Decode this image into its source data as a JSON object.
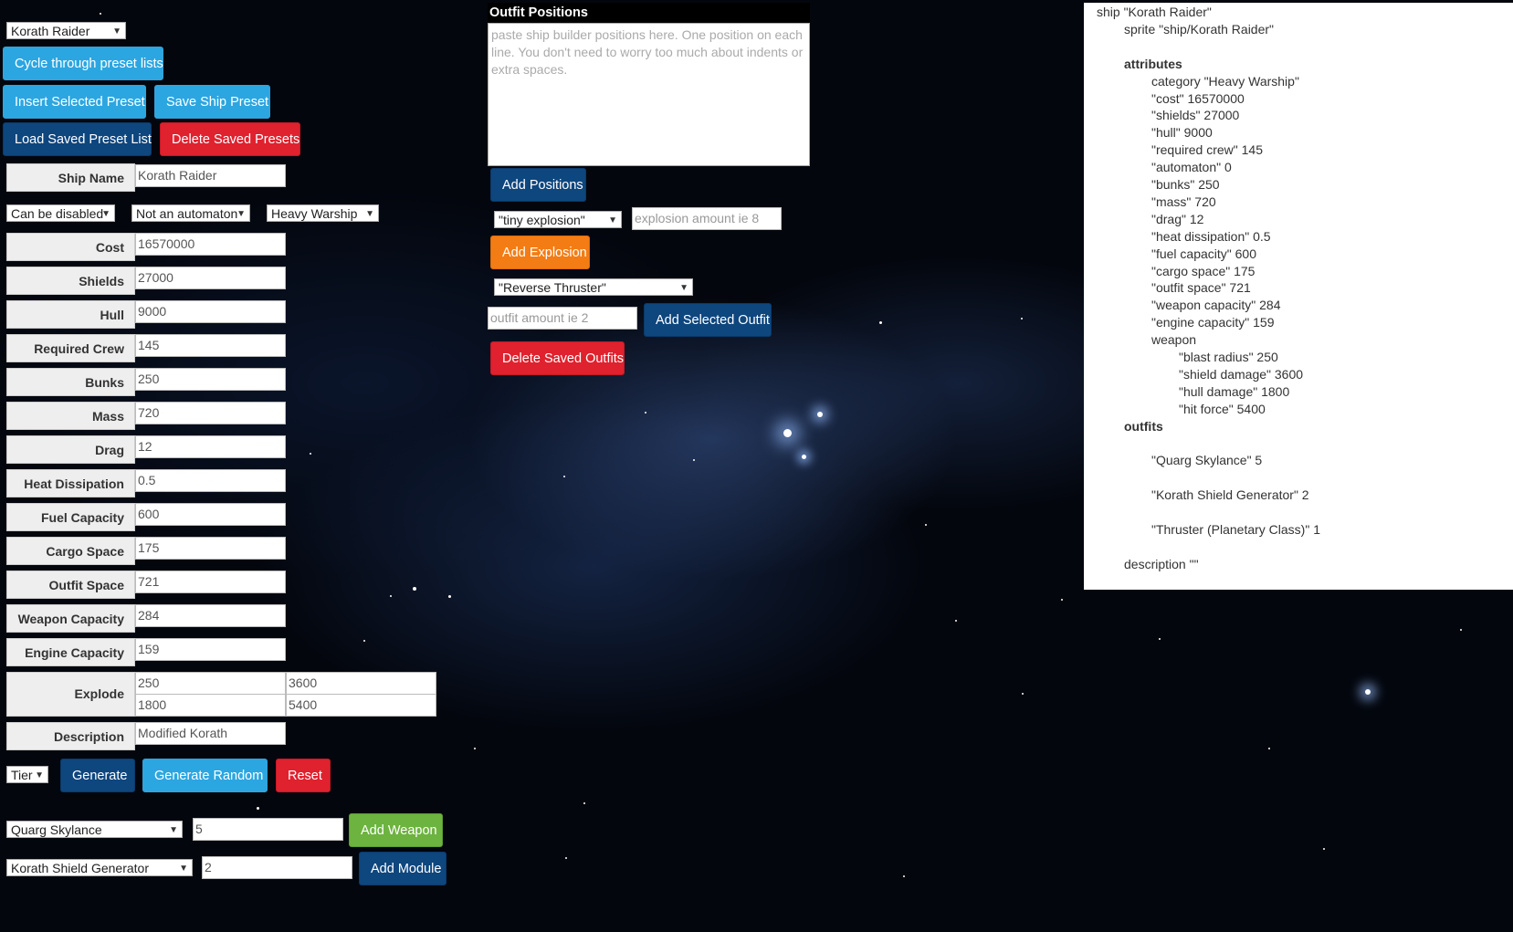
{
  "preset": {
    "selected": "Korath Raider",
    "cycle_label": "Cycle through preset lists",
    "insert_label": "Insert Selected Preset",
    "save_label": "Save Ship Preset",
    "load_label": "Load Saved Preset List",
    "delete_label": "Delete Saved Presets"
  },
  "ship_name": {
    "label": "Ship Name",
    "value": "Korath Raider"
  },
  "selects": {
    "disable": "Can be disabled",
    "automaton": "Not an automaton",
    "category": "Heavy Warship"
  },
  "fields": [
    {
      "label": "Cost",
      "value": "16570000"
    },
    {
      "label": "Shields",
      "value": "27000"
    },
    {
      "label": "Hull",
      "value": "9000"
    },
    {
      "label": "Required Crew",
      "value": "145"
    },
    {
      "label": "Bunks",
      "value": "250"
    },
    {
      "label": "Mass",
      "value": "720"
    },
    {
      "label": "Drag",
      "value": "12"
    },
    {
      "label": "Heat Dissipation",
      "value": "0.5"
    },
    {
      "label": "Fuel Capacity",
      "value": "600"
    },
    {
      "label": "Cargo Space",
      "value": "175"
    },
    {
      "label": "Outfit Space",
      "value": "721"
    },
    {
      "label": "Weapon Capacity",
      "value": "284"
    },
    {
      "label": "Engine Capacity",
      "value": "159"
    }
  ],
  "explode": {
    "label": "Explode",
    "blast_radius": "250",
    "shield_damage": "3600",
    "hull_damage": "1800",
    "hit_force": "5400"
  },
  "description": {
    "label": "Description",
    "value": "Modified Korath"
  },
  "generate": {
    "tier": "Tier",
    "generate_label": "Generate",
    "random_label": "Generate Random",
    "reset_label": "Reset"
  },
  "weapon": {
    "selected": "Quarg Skylance",
    "amount": "5",
    "add_label": "Add Weapon"
  },
  "module": {
    "selected": "Korath Shield Generator",
    "amount": "2",
    "add_label": "Add Module"
  },
  "outfit_positions": {
    "title": "Outfit Positions",
    "placeholder": "paste ship builder positions here. One position on each line. You don't need to worry too much about indents or extra spaces.",
    "add_positions_label": "Add Positions",
    "explosion_selected": "\"tiny explosion\"",
    "explosion_placeholder": "explosion amount ie 8",
    "add_explosion_label": "Add Explosion",
    "outfit_selected": "\"Reverse Thruster\"",
    "outfit_placeholder": "outfit amount ie 2",
    "add_outfit_label": "Add Selected Outfit",
    "delete_outfits_label": "Delete Saved Outfits"
  },
  "output": {
    "lines": [
      {
        "text": "ship \"Korath Raider\"",
        "indent": 0,
        "bold": false
      },
      {
        "text": "sprite \"ship/Korath Raider\"",
        "indent": 1,
        "bold": false
      },
      {
        "text": "",
        "indent": 0,
        "bold": false
      },
      {
        "text": "attributes",
        "indent": 1,
        "bold": true
      },
      {
        "text": "category \"Heavy Warship\"",
        "indent": 2,
        "bold": false
      },
      {
        "text": "\"cost\" 16570000",
        "indent": 2,
        "bold": false
      },
      {
        "text": "\"shields\" 27000",
        "indent": 2,
        "bold": false
      },
      {
        "text": "\"hull\" 9000",
        "indent": 2,
        "bold": false
      },
      {
        "text": "\"required crew\" 145",
        "indent": 2,
        "bold": false
      },
      {
        "text": "\"automaton\" 0",
        "indent": 2,
        "bold": false
      },
      {
        "text": "\"bunks\" 250",
        "indent": 2,
        "bold": false
      },
      {
        "text": "\"mass\" 720",
        "indent": 2,
        "bold": false
      },
      {
        "text": "\"drag\" 12",
        "indent": 2,
        "bold": false
      },
      {
        "text": "\"heat dissipation\" 0.5",
        "indent": 2,
        "bold": false
      },
      {
        "text": "\"fuel capacity\" 600",
        "indent": 2,
        "bold": false
      },
      {
        "text": "\"cargo space\" 175",
        "indent": 2,
        "bold": false
      },
      {
        "text": "\"outfit space\" 721",
        "indent": 2,
        "bold": false
      },
      {
        "text": "\"weapon capacity\" 284",
        "indent": 2,
        "bold": false
      },
      {
        "text": "\"engine capacity\" 159",
        "indent": 2,
        "bold": false
      },
      {
        "text": "weapon",
        "indent": 2,
        "bold": false
      },
      {
        "text": "\"blast radius\" 250",
        "indent": 3,
        "bold": false
      },
      {
        "text": "\"shield damage\" 3600",
        "indent": 3,
        "bold": false
      },
      {
        "text": "\"hull damage\" 1800",
        "indent": 3,
        "bold": false
      },
      {
        "text": "\"hit force\" 5400",
        "indent": 3,
        "bold": false
      },
      {
        "text": "outfits",
        "indent": 1,
        "bold": true
      },
      {
        "text": "",
        "indent": 0,
        "bold": false
      },
      {
        "text": "\"Quarg Skylance\" 5",
        "indent": 2,
        "bold": false
      },
      {
        "text": "",
        "indent": 0,
        "bold": false
      },
      {
        "text": "\"Korath Shield Generator\" 2",
        "indent": 2,
        "bold": false
      },
      {
        "text": "",
        "indent": 0,
        "bold": false
      },
      {
        "text": "\"Thruster (Planetary Class)\" 1",
        "indent": 2,
        "bold": false
      },
      {
        "text": "",
        "indent": 0,
        "bold": false
      },
      {
        "text": "description \"\"",
        "indent": 1,
        "bold": false
      }
    ]
  }
}
